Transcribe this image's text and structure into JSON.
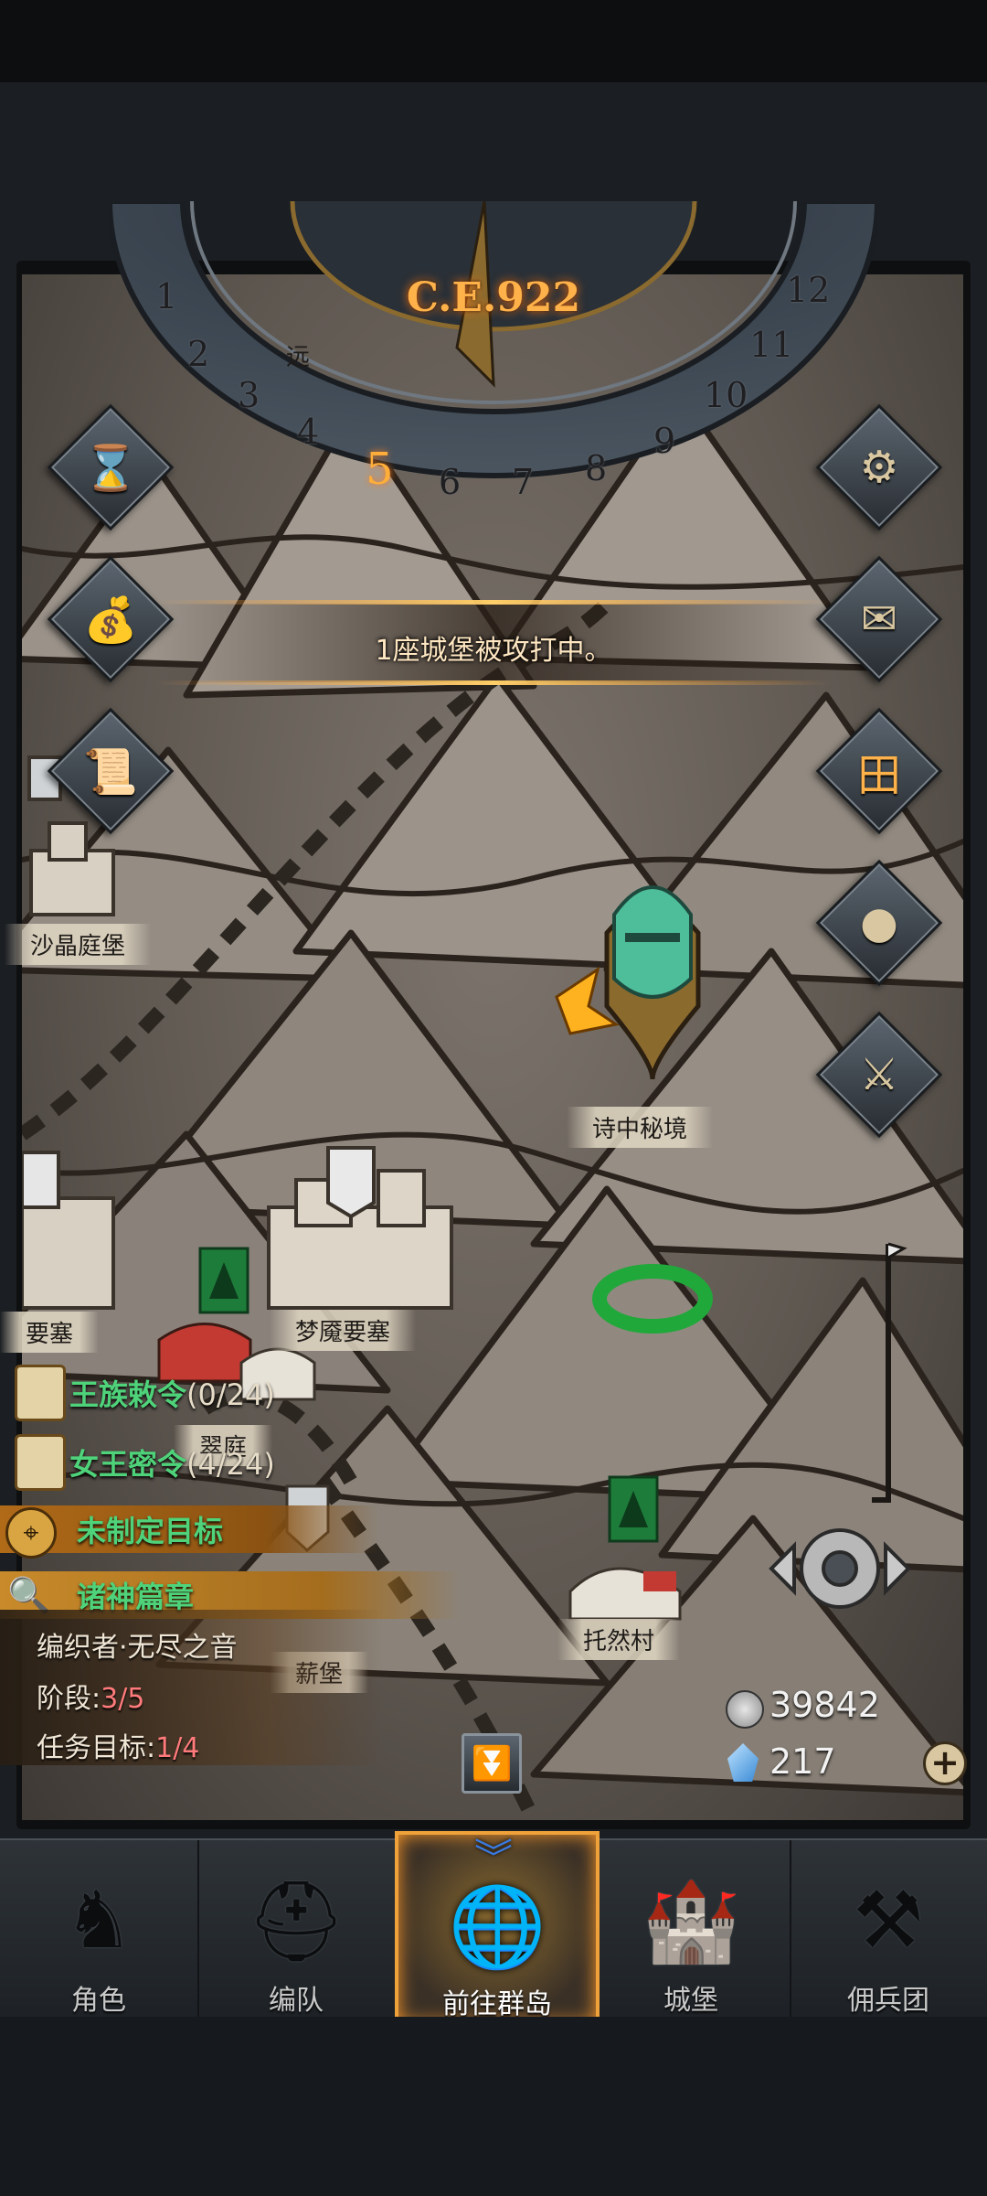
{
  "calendar": {
    "era": "C.E.922",
    "months": [
      "1",
      "2",
      "3",
      "4",
      "5",
      "6",
      "7",
      "8",
      "9",
      "10",
      "11",
      "12"
    ],
    "current_month": "5"
  },
  "notice": {
    "text": "1座城堡被攻打中。"
  },
  "left_buttons": [
    {
      "name": "hourglass-icon"
    },
    {
      "name": "money-bag-icon"
    },
    {
      "name": "scroll-icon"
    }
  ],
  "right_buttons": [
    {
      "name": "settings-gear-icon"
    },
    {
      "name": "mail-icon"
    },
    {
      "name": "map-grid-icon"
    },
    {
      "name": "coin-icon"
    },
    {
      "name": "helmet-sword-icon"
    }
  ],
  "places": {
    "shajing": "沙晶庭堡",
    "poem": "诗中秘境",
    "fortress_left": "要塞",
    "dream": "梦魇要塞",
    "court": "翠庭",
    "torran": "托然村",
    "xinbao": "薪堡",
    "far": "远"
  },
  "quests": {
    "royal_order": {
      "label": "王族敕令",
      "count": "(0/24)"
    },
    "queen_order": {
      "label": "女王密令",
      "count": "(4/24)"
    },
    "unset_goal": "未制定目标",
    "gods_chapter": "诸神篇章",
    "detail": {
      "title": "编织者·无尽之音",
      "stage_label": "阶段:",
      "stage_value": "3/5",
      "target_label": "任务目标:",
      "target_value": "1/4"
    }
  },
  "currency": {
    "silver": "39842",
    "crystal": "217"
  },
  "nav": [
    {
      "label": "角色",
      "icon": "knight-icon"
    },
    {
      "label": "编队",
      "icon": "helmet-icon"
    },
    {
      "label": "前往群岛",
      "icon": "globe-icon"
    },
    {
      "label": "城堡",
      "icon": "castle-icon"
    },
    {
      "label": "佣兵团",
      "icon": "mercenary-icon"
    }
  ],
  "colors": {
    "accent": "#f0a23a",
    "quest_green": "#4fd37a",
    "progress_red": "#ff7b7b"
  }
}
